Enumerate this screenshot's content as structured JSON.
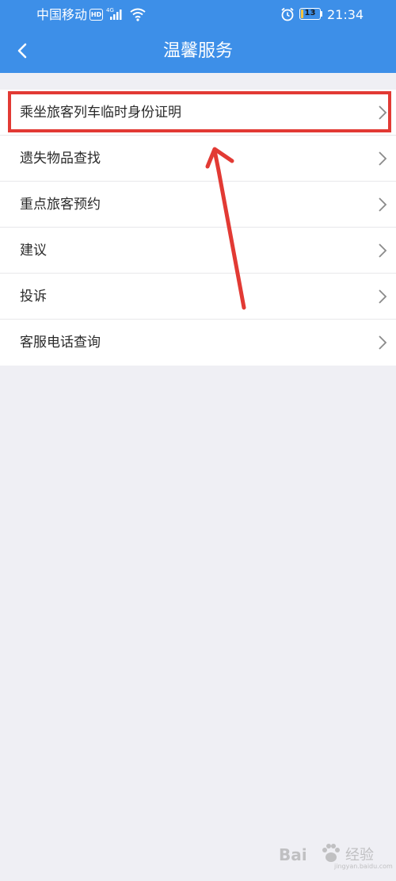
{
  "status_bar": {
    "carrier": "中国移动",
    "hd_badge": "HD",
    "network_type": "4G",
    "battery_level": "13",
    "battery_percent": 13,
    "time": "21:34"
  },
  "nav": {
    "title": "温馨服务",
    "back_icon": "chevron-left-icon"
  },
  "menu": {
    "items": [
      {
        "label": "乘坐旅客列车临时身份证明"
      },
      {
        "label": "遗失物品查找"
      },
      {
        "label": "重点旅客预约"
      },
      {
        "label": "建议"
      },
      {
        "label": "投诉"
      },
      {
        "label": "客服电话查询"
      }
    ],
    "chevron_icon": "chevron-right-icon"
  },
  "annotation": {
    "highlight_color": "#e23a34",
    "highlighted_item": 0
  },
  "watermark": {
    "brand": "Bai",
    "sub": "经验",
    "url": "jingyan.baidu.com"
  },
  "colors": {
    "header_bg": "#3d8fe8",
    "page_bg": "#efeff4",
    "item_text": "#2a2a2a",
    "battery": "#f6c43e"
  }
}
